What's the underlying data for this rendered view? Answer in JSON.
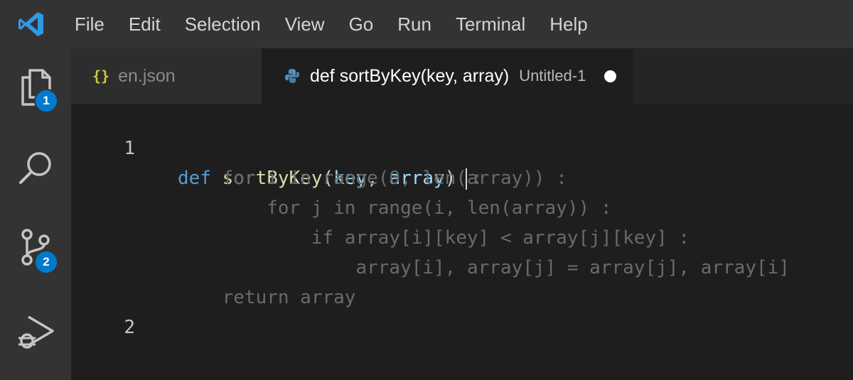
{
  "menu": {
    "items": [
      "File",
      "Edit",
      "Selection",
      "View",
      "Go",
      "Run",
      "Terminal",
      "Help"
    ]
  },
  "activity_bar": {
    "explorer_badge": "1",
    "source_control_badge": "2"
  },
  "tabs": {
    "inactive_icon": "{}",
    "inactive_label": "en.json",
    "active_label": "def sortByKey(key, array)",
    "active_description": "Untitled-1"
  },
  "editor": {
    "line_numbers": [
      "1",
      "2"
    ],
    "line1": {
      "kw_def": "def",
      "fn_name": "sortByKey",
      "open_paren": "(",
      "param_key": "key",
      "comma": ", ",
      "param_array": "array",
      "close_paren": ")",
      "ghost_colon": ":"
    },
    "suggestion_lines": [
      "    for i in range(0, len(array)) :",
      "        for j in range(i, len(array)) :",
      "            if array[i][key] < array[j][key] :",
      "                array[i], array[j] = array[j], array[i]",
      "    return array"
    ]
  },
  "colors": {
    "menubar": "#333333",
    "editor_bg": "#1e1e1e",
    "keyword": "#569cd6",
    "function": "#dcdcaa",
    "parameter": "#9cdcfe",
    "ghost_text": "#6a6a6a",
    "badge": "#007acc"
  }
}
